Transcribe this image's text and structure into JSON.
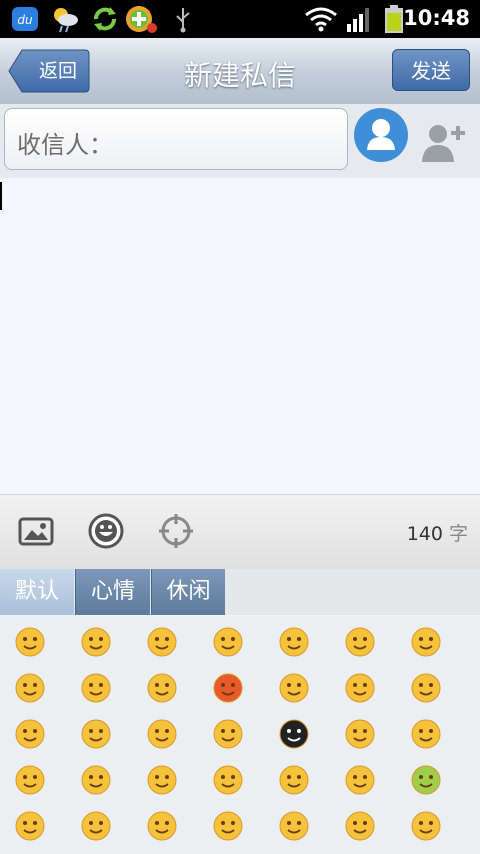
{
  "status_bar": {
    "time": "10:48"
  },
  "header": {
    "back_label": "返回",
    "title": "新建私信",
    "send_label": "发送"
  },
  "recipient": {
    "label": "收信人："
  },
  "editor": {
    "text": ""
  },
  "toolbar": {
    "count": "140",
    "count_unit": "字"
  },
  "emoji_tabs": [
    {
      "label": "默认",
      "active": true
    },
    {
      "label": "心情",
      "active": false
    },
    {
      "label": "休闲",
      "active": false
    }
  ],
  "emojis": [
    [
      "smile",
      "grin",
      "laugh",
      "blush-eyes",
      "dizzy",
      "cry",
      "tongue"
    ],
    [
      "scream",
      "tired",
      "giggle",
      "angry",
      "meh",
      "content",
      "shy"
    ],
    [
      "yawn",
      "money",
      "think",
      "cool",
      "black",
      "surprised",
      "wow"
    ],
    [
      "curse",
      "upset",
      "heart-eyes",
      "clap",
      "shock",
      "ponder",
      "sick"
    ],
    [
      "sleepy",
      "grimace",
      "chuckle",
      "hmm",
      "annoyed",
      "bored",
      "pout"
    ]
  ],
  "colors": {
    "accent": "#3f6aa6",
    "emoji_face": "#f5c33b"
  }
}
